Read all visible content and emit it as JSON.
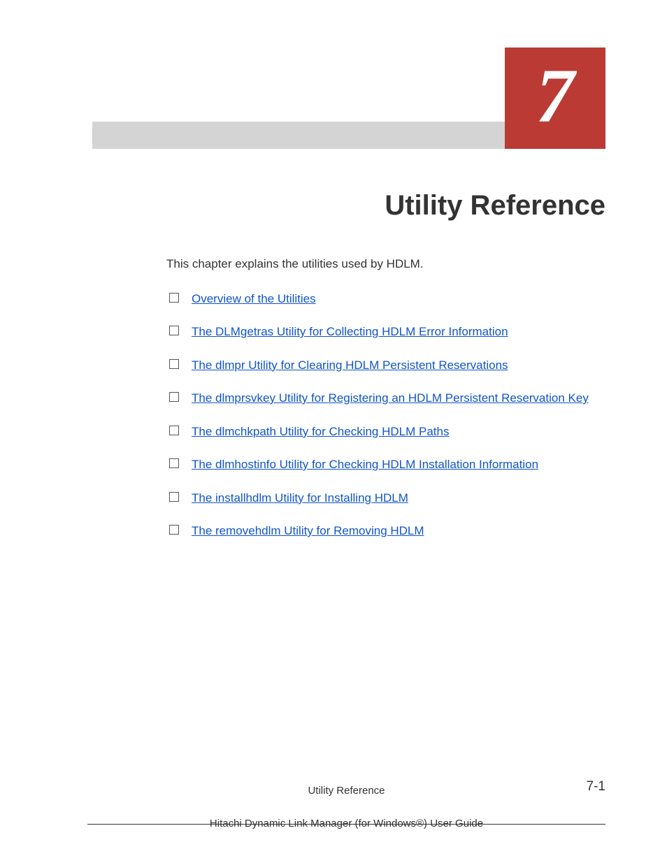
{
  "chapter_number": "7",
  "title": "Utility Reference",
  "intro": "This chapter explains the utilities used by HDLM.",
  "toc": [
    "Overview of the Utilities",
    "The DLMgetras Utility for Collecting HDLM Error Information",
    "The dlmpr Utility for Clearing HDLM Persistent Reservations",
    "The dlmprsvkey Utility for Registering an HDLM Persistent Reservation Key",
    "The dlmchkpath Utility for Checking HDLM Paths",
    "The dlmhostinfo Utility for Checking HDLM Installation Information",
    "The installhdlm Utility for Installing HDLM",
    "The removehdlm Utility for Removing HDLM"
  ],
  "footer": {
    "section": "Utility Reference",
    "guide": "Hitachi Dynamic Link Manager (for Windows®) User Guide",
    "page": "7-1"
  }
}
